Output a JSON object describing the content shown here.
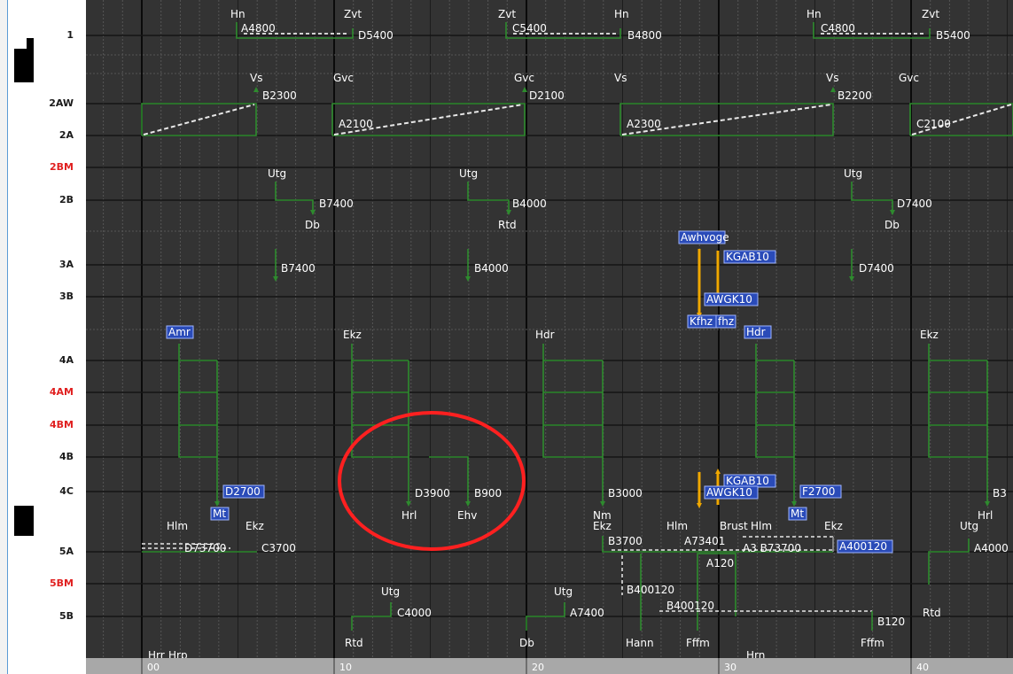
{
  "tracks": [
    {
      "label": "1"
    },
    {
      "label": "2AW"
    },
    {
      "label": "2A"
    },
    {
      "label": "2BM",
      "color": "#e02020"
    },
    {
      "label": "2B"
    },
    {
      "label": "3A"
    },
    {
      "label": "3B"
    },
    {
      "label": "4A"
    },
    {
      "label": "4AM",
      "color": "#e02020"
    },
    {
      "label": "4BM",
      "color": "#e02020"
    },
    {
      "label": "4B"
    },
    {
      "label": "4C"
    },
    {
      "label": "5A"
    },
    {
      "label": "5BM",
      "color": "#e02020"
    },
    {
      "label": "5B"
    }
  ],
  "time_ticks": [
    "00",
    "10",
    "20",
    "30",
    "40"
  ],
  "texts": [
    "Hn",
    "Zvt",
    "Zvt",
    "Hn",
    "Hn",
    "Zvt",
    "A4800",
    "D5400",
    "C5400",
    "B4800",
    "C4800",
    "B5400",
    "Vs",
    "Gvc",
    "Gvc",
    "Vs",
    "Vs",
    "Gvc",
    "B2300",
    "D2100",
    "B2200",
    "A2100",
    "A2300",
    "C2100",
    "Utg",
    "Utg",
    "Utg",
    "B7400",
    "B4000",
    "D7400",
    "Db",
    "Rtd",
    "Db",
    "B7400",
    "B4000",
    "D7400",
    "Ekz",
    "Hdr",
    "Ekz",
    "D3900",
    "B900",
    "B3000",
    "B3",
    "Hrl",
    "Ehv",
    "Nm",
    "Ekz",
    "Hrl",
    "Utg",
    "Hlm",
    "Ekz",
    "C3700",
    "D73700",
    "B3700",
    "A73401",
    "Hlm",
    "Brust",
    "Hlm",
    "Ekz",
    "A3 B73700",
    "A4000",
    "A120",
    "B400120",
    "B400120",
    "B120",
    "Utg",
    "Utg",
    "C4000",
    "A7400",
    "Rtd",
    "Db",
    "Rtd",
    "Hann",
    "Fffm",
    "Fffm",
    "Hrr",
    "Hrp",
    "Hrn"
  ],
  "tags": [
    "Amr",
    "D2700",
    "Mt",
    "Awhvoge",
    "KGAB10",
    "AWGK10",
    "Kfhz",
    "fhz",
    "Hdr",
    "KGAB10",
    "AWGK10",
    "F2700",
    "Mt",
    "A400120"
  ],
  "colors": {
    "background": "#333333",
    "train_line": "#2e8b2e",
    "dashed": "#e8e8e8",
    "orange_arrow": "#f0a800",
    "tag_bg": "#2a4bb8",
    "highlight_circle": "#ff2020"
  }
}
